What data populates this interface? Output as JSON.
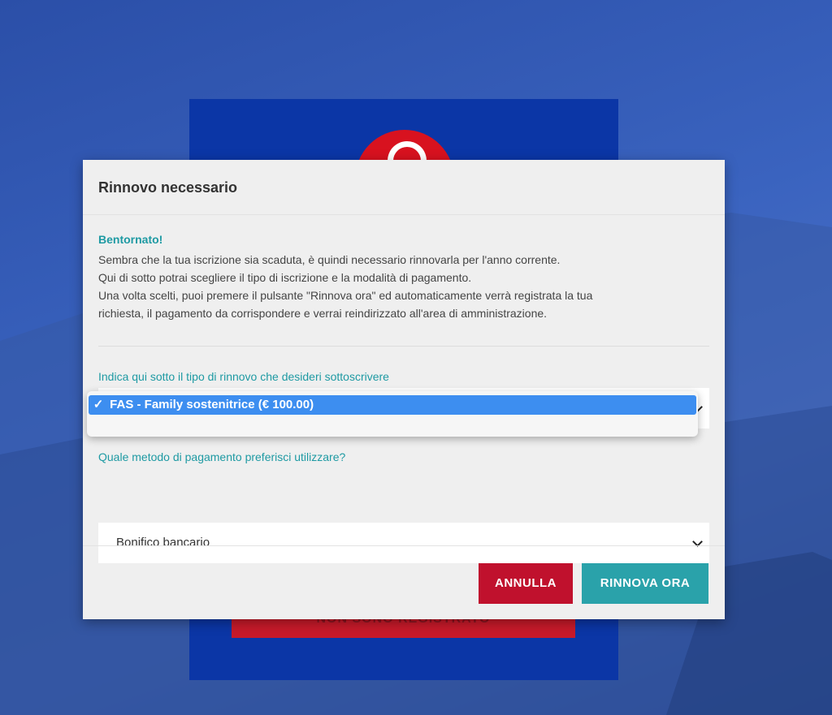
{
  "modal": {
    "title": "Rinnovo necessario",
    "greeting": "Bentornato!",
    "intro_lines": [
      "Sembra che la tua iscrizione sia scaduta, è quindi necessario rinnovarla per l'anno corrente.",
      "Qui di sotto potrai scegliere il tipo di iscrizione e la modalità di pagamento.",
      "Una volta scelti, puoi premere il pulsante \"Rinnova ora\" ed automaticamente verrà registrata la tua",
      "richiesta, il pagamento da corrispondere e verrai reindirizzato all'area di amministrazione."
    ],
    "type_label": "Indica qui sotto il tipo di rinnovo che desideri sottoscrivere",
    "type_dropdown": {
      "check": "✓",
      "selected_option": "FAS - Family sostenitrice (€ 100.00)"
    },
    "payment_label": "Quale metodo di pagamento preferisci utilizzare?",
    "payment_value": "Bonifico bancario",
    "cancel_button": "ANNULLA",
    "renew_button": "RINNOVA ORA"
  },
  "background": {
    "register_button": "NON SONO REGISTRATO"
  },
  "colors": {
    "accent_teal": "#1e9aa3",
    "cancel_red": "#c0112d",
    "renew_teal": "#2aa2aa",
    "selection_blue": "#3d8ef0",
    "login_blue": "#0b36a6"
  }
}
